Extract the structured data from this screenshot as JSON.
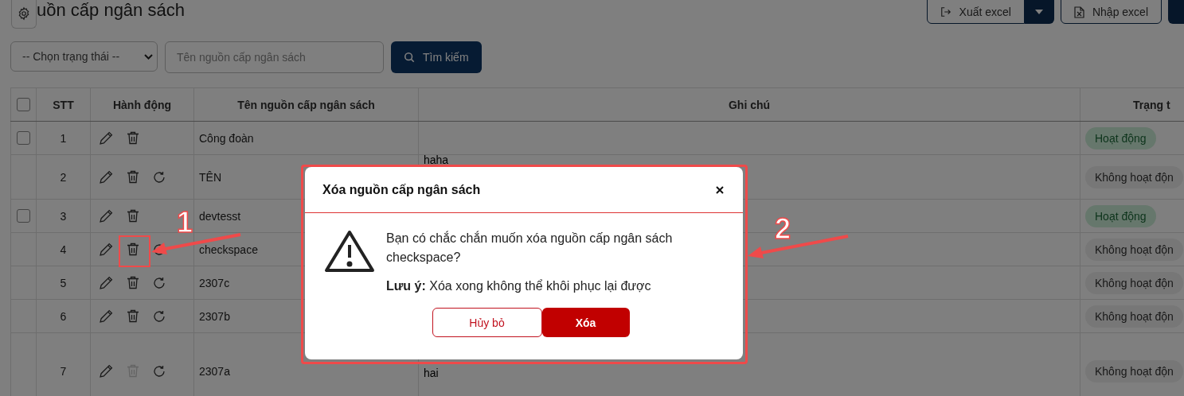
{
  "page": {
    "title": "uồn cấp ngân sách"
  },
  "toolbar": {
    "export_button": "Xuất excel",
    "import_button": "Nhập excel"
  },
  "filters": {
    "status_select": "-- Chọn trạng thái --",
    "name_placeholder": "Tên nguồn cấp ngân sách",
    "search_button": "Tìm kiếm"
  },
  "table": {
    "header_checked": false,
    "columns": [
      "STT",
      "Hành động",
      "Tên nguồn cấp ngân sách",
      "Ghi chú",
      "Trạng t"
    ],
    "rows": [
      {
        "stt": "1",
        "name": "Công đoàn",
        "note": "",
        "status": "Hoạt động",
        "active": true,
        "checked": false,
        "delete_disabled": false,
        "restorable": false
      },
      {
        "stt": "2",
        "name": "TÊN",
        "note": "haha",
        "status": "Không hoạt độn",
        "active": false,
        "delete_disabled": false,
        "restorable": true
      },
      {
        "stt": "3",
        "name": "devtesst",
        "note": "",
        "status": "Hoạt động",
        "active": true,
        "checked": false,
        "delete_disabled": false,
        "restorable": false
      },
      {
        "stt": "4",
        "name": "checkspace",
        "note": "",
        "status": "Không hoạt độn",
        "active": false,
        "delete_disabled": false,
        "restorable": true
      },
      {
        "stt": "5",
        "name": "2307c",
        "note": "",
        "status": "Không hoạt độn",
        "active": false,
        "delete_disabled": false,
        "restorable": true
      },
      {
        "stt": "6",
        "name": "2307b",
        "note": "",
        "status": "Không hoạt độn",
        "active": false,
        "delete_disabled": false,
        "restorable": true
      },
      {
        "stt": "7",
        "name": "2307a",
        "note": "hai",
        "status": "Không hoạt độn",
        "active": false,
        "delete_disabled": true,
        "restorable": true
      }
    ]
  },
  "dialog": {
    "title": "Xóa nguồn cấp ngân sách",
    "message": "Bạn có chắc chắn muốn xóa nguồn cấp ngân sách checkspace?",
    "note": "**Lưu ý:** Xóa xong không thể khôi phục lại được",
    "cancel_button": "Hủy bỏ",
    "confirm_button": "Xóa"
  },
  "annotations": [
    {
      "label": "1"
    },
    {
      "label": "2"
    }
  ]
}
